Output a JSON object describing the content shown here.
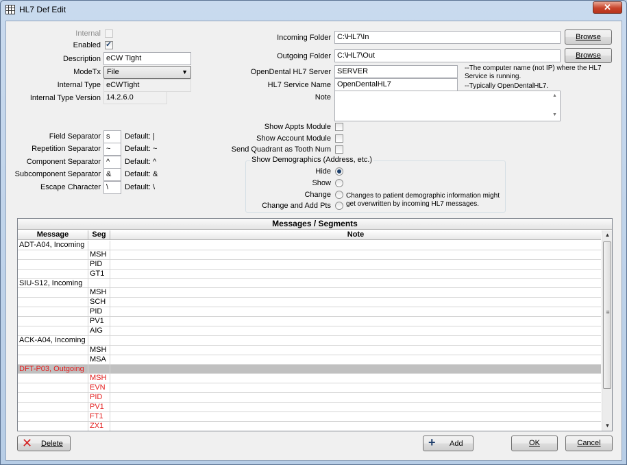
{
  "window": {
    "title": "HL7 Def Edit",
    "close_label": "✕"
  },
  "left_fields": {
    "internal_label": "Internal",
    "enabled_label": "Enabled",
    "enabled_checked": true,
    "internal_checked": false,
    "description_label": "Description",
    "description_value": "eCW Tight",
    "modetx_label": "ModeTx",
    "modetx_value": "File",
    "internal_type_label": "Internal Type",
    "internal_type_value": "eCWTight",
    "internal_type_version_label": "Internal Type Version",
    "internal_type_version_value": "14.2.6.0"
  },
  "separators": [
    {
      "label": "Field Separator",
      "value": "s",
      "default": "Default: |"
    },
    {
      "label": "Repetition Separator",
      "value": "~",
      "default": "Default: ~"
    },
    {
      "label": "Component Separator",
      "value": "^",
      "default": "Default: ^"
    },
    {
      "label": "Subcomponent Separator",
      "value": "&",
      "default": "Default: &"
    },
    {
      "label": "Escape Character",
      "value": "\\",
      "default": "Default: \\"
    }
  ],
  "right_fields": {
    "incoming_folder_label": "Incoming Folder",
    "incoming_folder_value": "C:\\HL7\\In",
    "outgoing_folder_label": "Outgoing Folder",
    "outgoing_folder_value": "C:\\HL7\\Out",
    "browse_label": "Browse",
    "server_label": "OpenDental HL7 Server",
    "server_value": "SERVER",
    "server_hint": "--The computer name (not IP) where the HL7 Service is running.",
    "service_label": "HL7 Service Name",
    "service_value": "OpenDentalHL7",
    "service_hint": "--Typically OpenDentalHL7.",
    "note_label": "Note",
    "note_value": ""
  },
  "modules": [
    {
      "label": "Show Appts Module",
      "checked": false
    },
    {
      "label": "Show Account Module",
      "checked": false
    },
    {
      "label": "Send Quadrant as Tooth Num",
      "checked": false
    }
  ],
  "demographics": {
    "title": "Show Demographics (Address, etc.)",
    "options": [
      "Hide",
      "Show",
      "Change",
      "Change and Add Pts"
    ],
    "selected": "Hide",
    "note": "Changes to patient demographic information might get overwritten by incoming HL7 messages."
  },
  "grid": {
    "title": "Messages / Segments",
    "columns": [
      "Message",
      "Seg",
      "Note"
    ],
    "rows": [
      {
        "message": "ADT-A04, Incoming",
        "seg": "",
        "note": "",
        "style": ""
      },
      {
        "message": "",
        "seg": "MSH",
        "note": "",
        "style": ""
      },
      {
        "message": "",
        "seg": "PID",
        "note": "",
        "style": ""
      },
      {
        "message": "",
        "seg": "GT1",
        "note": "",
        "style": ""
      },
      {
        "message": "SIU-S12, Incoming",
        "seg": "",
        "note": "",
        "style": ""
      },
      {
        "message": "",
        "seg": "MSH",
        "note": "",
        "style": ""
      },
      {
        "message": "",
        "seg": "SCH",
        "note": "",
        "style": ""
      },
      {
        "message": "",
        "seg": "PID",
        "note": "",
        "style": ""
      },
      {
        "message": "",
        "seg": "PV1",
        "note": "",
        "style": ""
      },
      {
        "message": "",
        "seg": "AIG",
        "note": "",
        "style": ""
      },
      {
        "message": "ACK-A04, Incoming",
        "seg": "",
        "note": "",
        "style": ""
      },
      {
        "message": "",
        "seg": "MSH",
        "note": "",
        "style": ""
      },
      {
        "message": "",
        "seg": "MSA",
        "note": "",
        "style": ""
      },
      {
        "message": "DFT-P03, Outgoing",
        "seg": "",
        "note": "",
        "style": "red sel"
      },
      {
        "message": "",
        "seg": "MSH",
        "note": "",
        "style": "red"
      },
      {
        "message": "",
        "seg": "EVN",
        "note": "",
        "style": "red"
      },
      {
        "message": "",
        "seg": "PID",
        "note": "",
        "style": "red"
      },
      {
        "message": "",
        "seg": "PV1",
        "note": "",
        "style": "red"
      },
      {
        "message": "",
        "seg": "FT1",
        "note": "",
        "style": "red"
      },
      {
        "message": "",
        "seg": "ZX1",
        "note": "",
        "style": "red"
      }
    ]
  },
  "buttons": {
    "delete": "Delete",
    "add": "Add",
    "ok": "OK",
    "cancel": "Cancel"
  },
  "colors": {
    "outgoing_red": "#e31b1b",
    "selected_row": "#c0c0c0"
  }
}
